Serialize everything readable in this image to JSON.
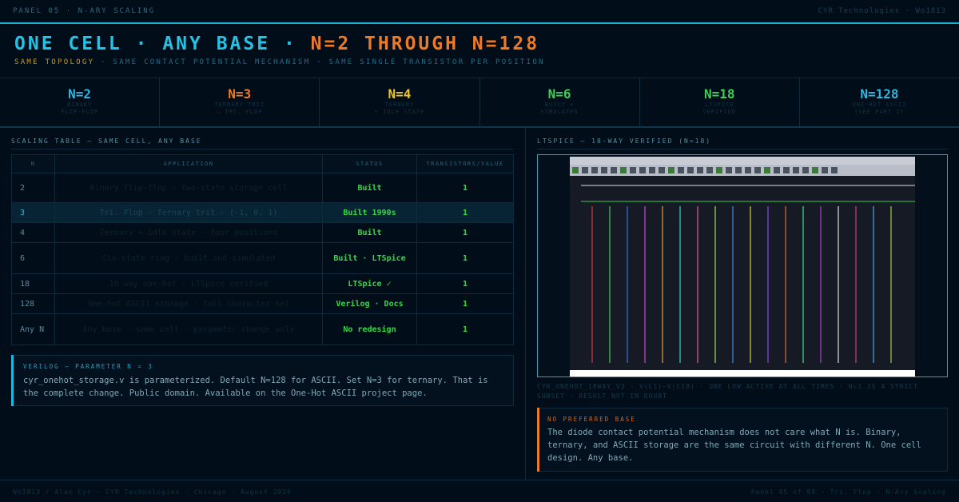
{
  "header": {
    "left": "PANEL 05 · N-ARY SCALING",
    "right": "CYR Technologies · Wo1813"
  },
  "title": {
    "part1": "ONE CELL · ANY BASE · ",
    "part2": "N=2 THROUGH N=128"
  },
  "subtitle": {
    "part1": "SAME TOPOLOGY",
    "part2": " · SAME CONTACT POTENTIAL MECHANISM · SAME SINGLE TRANSISTOR PER POSITION"
  },
  "stats": [
    {
      "value": "N=2",
      "color": "#2bb7df",
      "line1": "BINARY",
      "line2": "FLIP-FLOP"
    },
    {
      "value": "N=3",
      "color": "#ee7a24",
      "line1": "TERNARY TRIT",
      "line2": "— TRI. FLOP"
    },
    {
      "value": "N=4",
      "color": "#e8c62a",
      "line1": "TERNARY",
      "line2": "+ IDLE STATE"
    },
    {
      "value": "N=6",
      "color": "#3fcf55",
      "line1": "BUILT +",
      "line2": "SIMULATED"
    },
    {
      "value": "N=18",
      "color": "#3fcf55",
      "line1": "LTSPICE",
      "line2": "VERIFIED"
    },
    {
      "value": "N=128",
      "color": "#2bb7df",
      "line1": "ONE-HOT ASCII",
      "line2": "(SEE PART 2)"
    }
  ],
  "table": {
    "title": "SCALING TABLE — SAME CELL, ANY BASE",
    "headers": [
      "N",
      "APPLICATION",
      "STATUS",
      "TRANSISTORS/VALUE"
    ],
    "rows": [
      {
        "n": "2",
        "app": "Binary flip-flop · two-state storage cell",
        "status": "Built",
        "tv": "1"
      },
      {
        "n": "3",
        "app": "Tri. Flop · Ternary trit · (-1, 0, 1)",
        "status": "Built 1990s",
        "tv": "1"
      },
      {
        "n": "4",
        "app": "Ternary + idle state · four positions",
        "status": "Built",
        "tv": "1"
      },
      {
        "n": "6",
        "app": "Six-state ring · built and simulated",
        "status": "Built · LTSpice",
        "tv": "1"
      },
      {
        "n": "18",
        "app": "18-way one-hot · LTSpice verified",
        "status": "LTSpice ✓",
        "tv": "1"
      },
      {
        "n": "128",
        "app": "One-hot ASCII storage · full character set",
        "status": "Verilog · Docs",
        "tv": "1"
      },
      {
        "n": "Any N",
        "app": "Any base · same cell · parameter change only",
        "status": "No redesign",
        "tv": "1"
      }
    ]
  },
  "verilog_note": {
    "heading": "VERILOG — PARAMETER N = 3",
    "text": "cyr_onehot_storage.v is parameterized. Default N=128 for ASCII. Set N=3 for ternary. That is the complete change. Public domain. Available on the One-Hot ASCII project page."
  },
  "ltspice": {
    "title": "LTSPICE — 18-WAY VERIFIED (N=18)",
    "caption": "CYR_ONEHOT_18WAY_V3 · V(C1)–V(C18) · ONE LOW ACTIVE AT ALL TIMES · N=1 IS A STRICT SUBSET · RESULT NOT IN DOUBT",
    "trace_colors": [
      "#d23b3b",
      "#3fcf55",
      "#3b6fe0",
      "#c84ad8",
      "#e0a23b",
      "#2bd6c6",
      "#e85a9a",
      "#a3e04a",
      "#4a8ae0",
      "#d2d23b",
      "#8a4ae0",
      "#e06a3b",
      "#3be08a",
      "#b03bd2",
      "#e0e0e0",
      "#d23b7a",
      "#3bb0e0",
      "#9ad23b"
    ]
  },
  "no_preferred_base": {
    "heading": "NO PREFERRED BASE",
    "text": "The diode contact potential mechanism does not care what N is. Binary, ternary, and ASCII storage are the same circuit with different N. One cell design. Any base."
  },
  "footer": {
    "left": "Wo1813 / Alan Cyr · CYR Technologies · Chicago · August 2026",
    "right": "Panel 05 of 08 · Tri. Flop · N-Ary Scaling"
  }
}
